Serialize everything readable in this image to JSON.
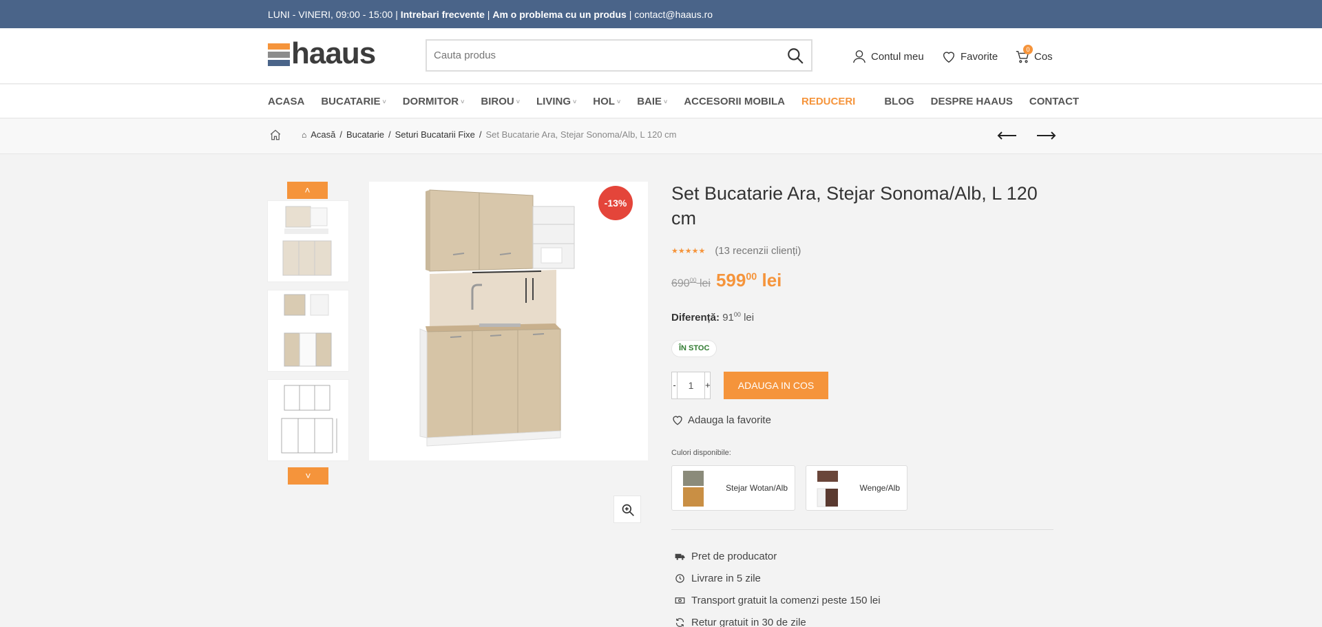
{
  "topbar": {
    "hours": "LUNI - VINERI, 09:00 - 15:00",
    "sep": "|",
    "faq": "Intrebari frecvente",
    "problem": "Am o problema cu un produs",
    "email": "contact@haaus.ro"
  },
  "header": {
    "logo_text": "haaus",
    "logo_colors": [
      "#f5943b",
      "#888888",
      "#4a6489"
    ],
    "search_placeholder": "Cauta produs",
    "account_label": "Contul meu",
    "favorites_label": "Favorite",
    "cart_label": "Cos",
    "cart_count": "0"
  },
  "nav": {
    "items": [
      {
        "label": "ACASA",
        "dropdown": false
      },
      {
        "label": "BUCATARIE",
        "dropdown": true
      },
      {
        "label": "DORMITOR",
        "dropdown": true
      },
      {
        "label": "BIROU",
        "dropdown": true
      },
      {
        "label": "LIVING",
        "dropdown": true
      },
      {
        "label": "HOL",
        "dropdown": true
      },
      {
        "label": "BAIE",
        "dropdown": true
      },
      {
        "label": "ACCESORII MOBILA",
        "dropdown": false
      },
      {
        "label": "REDUCERI",
        "dropdown": false,
        "highlight": true
      },
      {
        "label": "BLOG",
        "dropdown": false
      },
      {
        "label": "DESPRE HAAUS",
        "dropdown": false
      },
      {
        "label": "CONTACT",
        "dropdown": false
      }
    ]
  },
  "breadcrumb": {
    "items": [
      "Acasă",
      "Bucatarie",
      "Seturi Bucatarii Fixe"
    ],
    "separator": "/",
    "current": "Set Bucatarie Ara, Stejar Sonoma/Alb, L 120 cm"
  },
  "product": {
    "discount_badge": "-13%",
    "title": "Set Bucatarie Ara, Stejar Sonoma/Alb, L 120 cm",
    "stars": "★★★★★",
    "rating": 5,
    "reviews": "(13 recenzii clienți)",
    "old_price": {
      "int": "690",
      "dec": "00",
      "cur": "lei"
    },
    "new_price": {
      "int": "599",
      "dec": "00",
      "cur": "lei"
    },
    "difference_label": "Diferență:",
    "difference": {
      "int": "91",
      "dec": "00",
      "cur": "lei"
    },
    "stock": "ÎN STOC",
    "quantity": "1",
    "qty_minus": "-",
    "qty_plus": "+",
    "add_to_cart": "ADAUGA IN COS",
    "add_to_favorites": "Adauga la favorite",
    "colors_label": "Culori disponibile:",
    "variants": [
      {
        "label": "Stejar Wotan/Alb"
      },
      {
        "label": "Wenge/Alb"
      }
    ],
    "features": [
      {
        "icon": "truck-icon",
        "label": "Pret de producator"
      },
      {
        "icon": "clock-icon",
        "label": "Livrare in 5 zile"
      },
      {
        "icon": "money-icon",
        "label": "Transport gratuit la comenzi peste 150 lei"
      },
      {
        "icon": "refresh-icon",
        "label": "Retur gratuit in 30 de zile"
      }
    ]
  },
  "colors": {
    "accent": "#f5943b",
    "topbar": "#4a6489",
    "badge": "#e4453a",
    "stock_text": "#2f7a2f"
  }
}
